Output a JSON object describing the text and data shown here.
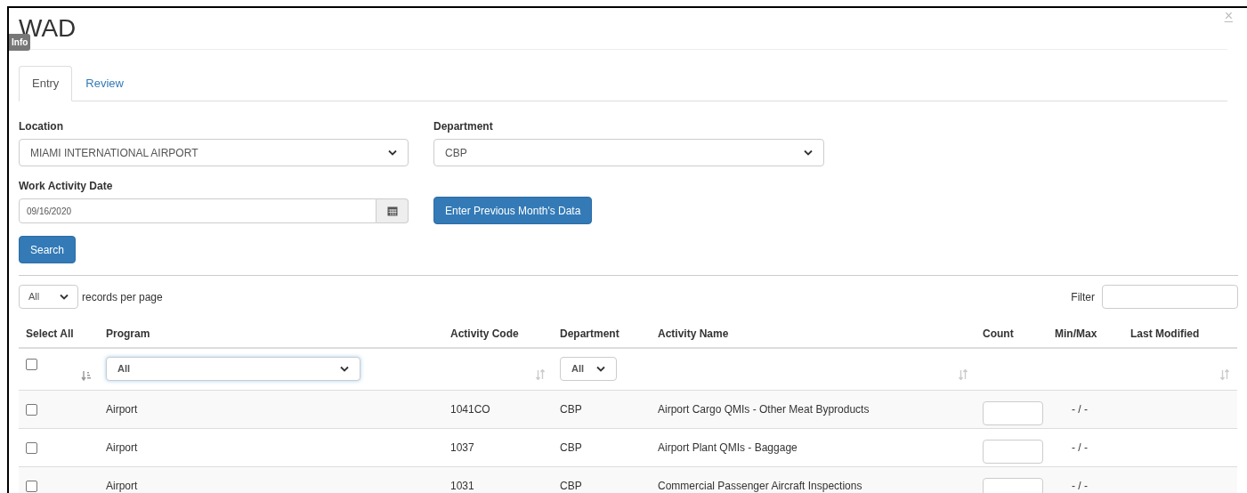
{
  "title": "WAD",
  "info_badge": "Info",
  "close": "×",
  "tabs": [
    {
      "label": "Entry",
      "selected": true
    },
    {
      "label": "Review",
      "selected": false
    }
  ],
  "location": {
    "label": "Location",
    "value": "MIAMI INTERNATIONAL AIRPORT"
  },
  "department": {
    "label": "Department",
    "value": "CBP"
  },
  "work_activity_date": {
    "label": "Work Activity Date",
    "value": "09/16/2020"
  },
  "previous_month_button": "Enter Previous Month's Data",
  "search_button": "Search",
  "page_length": {
    "value": "All",
    "suffix": "records per page"
  },
  "filter": {
    "label": "Filter"
  },
  "table": {
    "columns": [
      "Select All",
      "Program",
      "Activity Code",
      "Department",
      "Activity Name",
      "Count",
      "Min/Max",
      "Last Modified"
    ],
    "filter_row": {
      "select_all_checked": false,
      "program": "All",
      "department": "All"
    },
    "rows": [
      {
        "checked": false,
        "program": "Airport",
        "activity_code": "1041CO",
        "department": "CBP",
        "activity_name": "Airport Cargo QMIs - Other Meat Byproducts",
        "min_max": "- / -"
      },
      {
        "checked": false,
        "program": "Airport",
        "activity_code": "1037",
        "department": "CBP",
        "activity_name": "Airport Plant QMIs - Baggage",
        "min_max": "- / -"
      },
      {
        "checked": false,
        "program": "Airport",
        "activity_code": "1031",
        "department": "CBP",
        "activity_name": "Commercial Passenger Aircraft Inspections",
        "min_max": "- / -"
      }
    ]
  }
}
